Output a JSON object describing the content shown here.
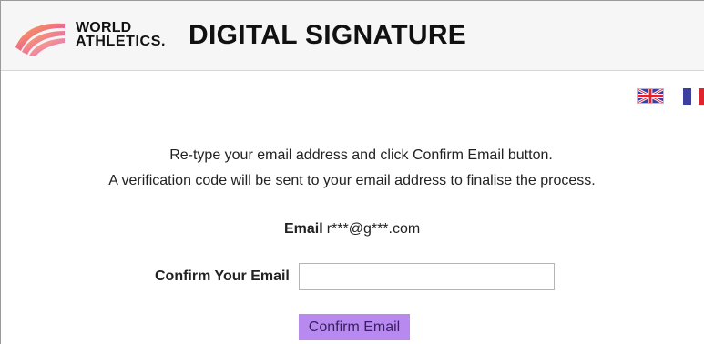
{
  "header": {
    "brand_line1": "WORLD",
    "brand_line2": "ATHLETICS.",
    "title": "DIGITAL SIGNATURE"
  },
  "languages": [
    {
      "icon": "uk-flag-icon"
    },
    {
      "icon": "france-flag-icon"
    }
  ],
  "instructions": {
    "line1": "Re-type your email address and click Confirm Email button.",
    "line2": "A verification code will be sent to your email address to finalise the process."
  },
  "email": {
    "label": "Email",
    "value": "r***@g***.com"
  },
  "confirm": {
    "label": "Confirm Your Email",
    "input_value": "",
    "input_placeholder": "",
    "button_label": "Confirm Email"
  },
  "colors": {
    "button_bg": "#b88af0",
    "header_bg": "#f6f6f6"
  }
}
